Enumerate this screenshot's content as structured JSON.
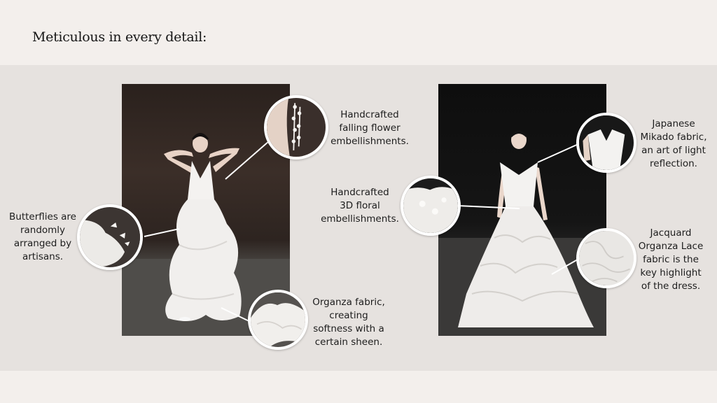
{
  "page": {
    "title": "Meticulous in every detail:"
  },
  "captions": {
    "falling_flower": "Handcrafted\nfalling flower\nembellishments.",
    "butterflies": "Butterflies are\nrandomly\narranged by\nartisans.",
    "organza": "Organza fabric,\ncreating\nsoftness with a\ncertain sheen.",
    "floral_3d": "Handcrafted\n3D floral\nembellishments.",
    "mikado": "Japanese\nMikado fabric,\nan art of light\nreflection.",
    "jacquard": "Jacquard\nOrganza Lace\nfabric is the\nkey highlight\nof the dress."
  },
  "colors": {
    "page_background": "#f3efec",
    "band_background": "#e6e2df",
    "text": "#1d1d1d"
  }
}
